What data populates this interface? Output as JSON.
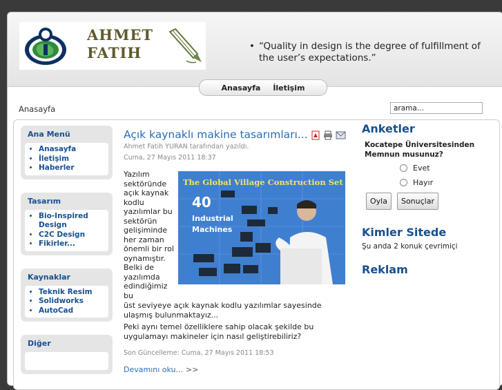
{
  "header": {
    "logo_line1": "AHMET",
    "logo_line2": "FATIH",
    "quote": "“Quality in design is the degree of fulfillment of the user’s expectations.”"
  },
  "nav": {
    "items": [
      {
        "label": "Anasayfa"
      },
      {
        "label": "İletişim"
      }
    ]
  },
  "breadcrumb": "Anasayfa",
  "search": {
    "value": "arama..."
  },
  "left": {
    "modules": [
      {
        "title": "Ana Menü",
        "items": [
          "Anasayfa",
          "İletişim",
          "Haberler"
        ]
      },
      {
        "title": "Tasarım",
        "items": [
          "Bio-Inspired Design",
          "C2C Design",
          "Fikirler..."
        ]
      },
      {
        "title": "Kaynaklar",
        "items": [
          "Teknik Resim",
          "Solidworks",
          "AutoCad"
        ]
      },
      {
        "title": "Diğer",
        "items": []
      }
    ]
  },
  "article": {
    "title": "Açık kaynaklı makine tasarımları...",
    "author": "Ahmet Fatih YURAN tarafından yazıldı.",
    "date": "Cuma, 27 Mayıs 2011 18:37",
    "lead_text": "Yazılım sektöründe açık kaynak kodlu yazılımlar bu sektörün gelişiminde her zaman önemli bir rol oynamıştır. Belki de yazılımda edindiğimiz bu",
    "cont_text": "üst seviyeye açık kaynak kodlu yazılımlar sayesinde ulaşmış bulunmaktayız...",
    "para2": "Peki aynı temel özelliklere sahip olacak şekilde bu uygulamayı makineler için nasıl geliştirebiliriz?",
    "last_update": "Son Güncelleme: Cuma, 27 Mayıs 2011 18:53",
    "read_more": "Devamını oku...",
    "read_more_arrow": ">>",
    "image": {
      "banner": "The Global Village Construction Set",
      "big": "40",
      "line1": "Industrial",
      "line2": "Machines"
    }
  },
  "right": {
    "polls_title": "Anketler",
    "poll_question": "Kocatepe Üniversitesinden Memnun musunuz?",
    "options": [
      "Evet",
      "Hayır"
    ],
    "vote_label": "Oyla",
    "results_label": "Sonuçlar",
    "who_title": "Kimler Sitede",
    "who_text": "Şu anda 2 konuk çevrimiçi",
    "ads_title": "Reklam"
  },
  "colors": {
    "accent": "#17508f",
    "link": "#2a6db5"
  },
  "icons": {
    "pdf": "pdf-icon",
    "print": "print-icon",
    "email": "email-icon"
  }
}
